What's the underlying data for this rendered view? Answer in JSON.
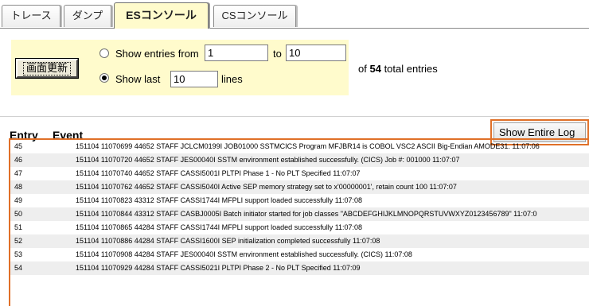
{
  "tabs": [
    {
      "label": "トレース",
      "active": false
    },
    {
      "label": "ダンプ",
      "active": false
    },
    {
      "label": "ESコンソール",
      "active": true
    },
    {
      "label": "CSコンソール",
      "active": false
    }
  ],
  "controls": {
    "refresh_label": "画面更新",
    "show_from_label": "Show entries from",
    "from_value": "1",
    "to_label": "to",
    "to_value": "10",
    "show_last_label": "Show last",
    "last_value": "10",
    "lines_label": "lines",
    "selected_option": "show_last",
    "total_prefix": "of",
    "total_count": "54",
    "total_suffix": "total entries"
  },
  "header": {
    "entry_label": "Entry",
    "event_label": "Event",
    "show_entire_log_label": "Show Entire Log"
  },
  "log_entries": [
    {
      "entry": "45",
      "event": "151104 11070699 44652 STAFF JCLCM0199I JOB01000 SSTMCICS Program MFJBR14 is COBOL VSC2 ASCII Big-Endian AMODE31. 11:07:06"
    },
    {
      "entry": "46",
      "event": "151104 11070720 44652 STAFF JES00040I SSTM environment established successfully. (CICS) Job #: 001000 11:07:07"
    },
    {
      "entry": "47",
      "event": "151104 11070740 44652 STAFF CASSI5001I PLTPI Phase 1 - No PLT Specified 11:07:07"
    },
    {
      "entry": "48",
      "event": "151104 11070762 44652 STAFF CASSI5040I Active SEP memory strategy set to x'00000001', retain count 100 11:07:07"
    },
    {
      "entry": "49",
      "event": "151104 11070823 43312 STAFF CASSI1744I MFPLI support loaded successfully 11:07:08"
    },
    {
      "entry": "50",
      "event": "151104 11070844 43312 STAFF CASBJ0005I Batch initiator started for job classes \"ABCDEFGHIJKLMNOPQRSTUVWXYZ0123456789\" 11:07:0"
    },
    {
      "entry": "51",
      "event": "151104 11070865 44284 STAFF CASSI1744I MFPLI support loaded successfully 11:07:08"
    },
    {
      "entry": "52",
      "event": "151104 11070886 44284 STAFF CASSI1600I SEP initialization completed successfully 11:07:08"
    },
    {
      "entry": "53",
      "event": "151104 11070908 44284 STAFF JES00040I SSTM environment established successfully. (CICS) 11:07:08"
    },
    {
      "entry": "54",
      "event": "151104 11070929 44284 STAFF CASSI5021I PLTPI Phase 2 - No PLT Specified 11:07:09"
    }
  ],
  "colors": {
    "panel_bg": "#fffbcc",
    "highlight_border": "#e07028",
    "alt_row": "#eeeeee"
  }
}
